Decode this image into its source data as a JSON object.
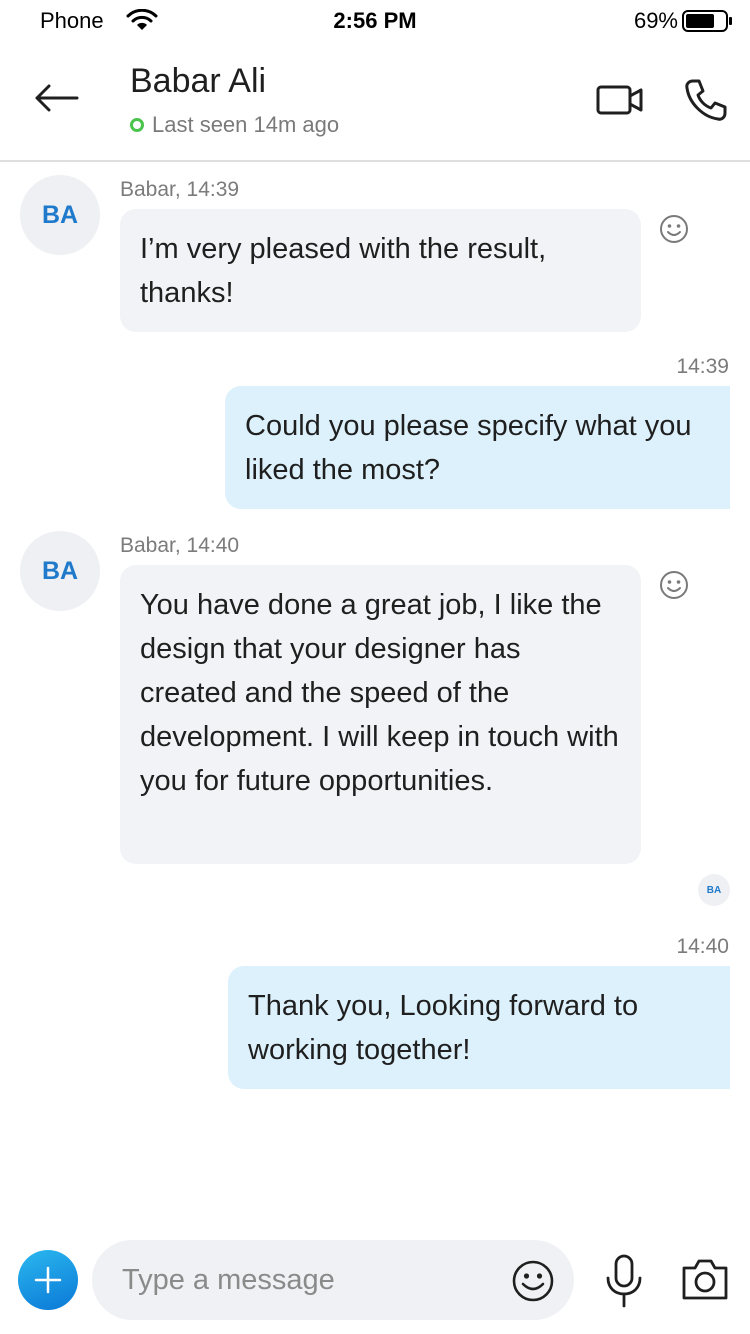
{
  "status_bar": {
    "carrier": "Phone",
    "time": "2:56 PM",
    "battery": "69%"
  },
  "header": {
    "name": "Babar Ali",
    "presence": "Last seen 14m ago"
  },
  "messages": [
    {
      "direction": "incoming",
      "meta": "Babar, 14:39",
      "avatar": "BA",
      "text": "I’m very pleased with the result, thanks!"
    },
    {
      "direction": "outgoing",
      "meta": "14:39",
      "text": "Could you please specify what you liked the most?"
    },
    {
      "direction": "incoming",
      "meta": "Babar, 14:40",
      "avatar": "BA",
      "text": "You have done a great job, I like the design that your designer has created and the speed of the development. I will keep in touch with you for future opportunities."
    },
    {
      "direction": "outgoing",
      "meta": "14:40",
      "text": "Thank you, Looking forward to working together!"
    }
  ],
  "read_receipt": "BA",
  "composer": {
    "placeholder": "Type a message"
  },
  "icons": {
    "back": "arrow-left-icon",
    "video": "video-camera-icon",
    "call": "phone-icon",
    "react": "smiley-icon",
    "add": "plus-icon",
    "emoji": "smiley-icon",
    "mic": "microphone-icon",
    "camera": "camera-icon"
  },
  "colors": {
    "accent": "#0a78d6",
    "online": "#4bc44b",
    "incoming_bubble": "#f1f3f6",
    "outgoing_bubble": "#dcf1fb"
  }
}
